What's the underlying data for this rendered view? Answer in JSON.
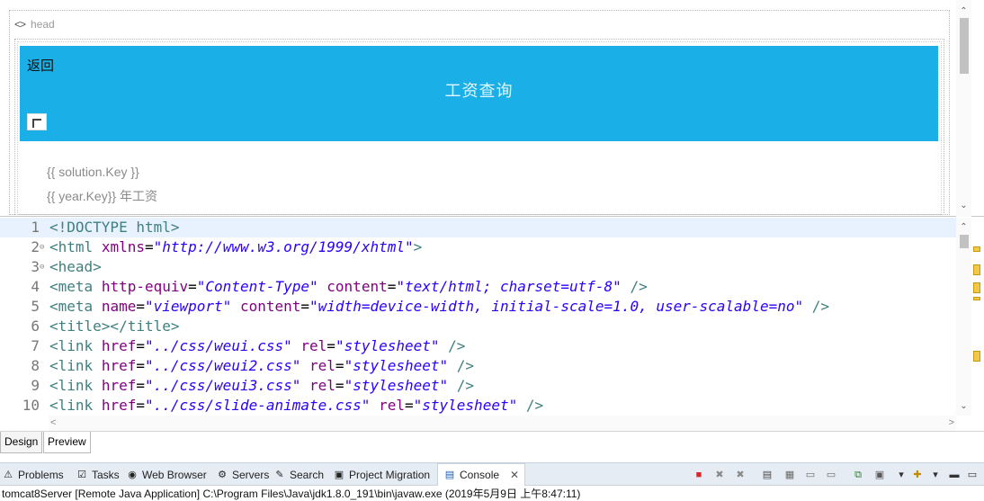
{
  "design": {
    "head_tag_icon": "<>",
    "head_tag": "head",
    "back_link": "返回",
    "page_heading": "工资查询",
    "template_line_1": "{{ solution.Key }}",
    "template_line_2": "{{ year.Key}} 年工资",
    "header_color": "#1aafe6"
  },
  "editor": {
    "lines": [
      {
        "num": "1",
        "fold": "",
        "current": true,
        "tokens": [
          {
            "t": "tag",
            "v": "<!DOCTYPE html>"
          }
        ]
      },
      {
        "num": "2",
        "fold": "⊖",
        "current": false,
        "tokens": [
          {
            "t": "tag",
            "v": "<html"
          },
          {
            "t": "txt",
            "v": " "
          },
          {
            "t": "attr",
            "v": "xmlns"
          },
          {
            "t": "txt",
            "v": "="
          },
          {
            "t": "str",
            "v": "\"http://www.w3.org/1999/xhtml\""
          },
          {
            "t": "tag",
            "v": ">"
          }
        ]
      },
      {
        "num": "3",
        "fold": "⊖",
        "current": false,
        "tokens": [
          {
            "t": "tag",
            "v": "<head>"
          }
        ]
      },
      {
        "num": "4",
        "fold": "",
        "current": false,
        "tokens": [
          {
            "t": "tag",
            "v": "<meta"
          },
          {
            "t": "txt",
            "v": " "
          },
          {
            "t": "attr",
            "v": "http-equiv"
          },
          {
            "t": "txt",
            "v": "="
          },
          {
            "t": "str",
            "v": "\"Content-Type\""
          },
          {
            "t": "txt",
            "v": " "
          },
          {
            "t": "attr",
            "v": "content"
          },
          {
            "t": "txt",
            "v": "="
          },
          {
            "t": "str",
            "v": "\"text/html; charset=utf-8\""
          },
          {
            "t": "txt",
            "v": " "
          },
          {
            "t": "tag",
            "v": "/>"
          }
        ]
      },
      {
        "num": "5",
        "fold": "",
        "current": false,
        "tokens": [
          {
            "t": "tag",
            "v": "<meta"
          },
          {
            "t": "txt",
            "v": " "
          },
          {
            "t": "attr",
            "v": "name"
          },
          {
            "t": "txt",
            "v": "="
          },
          {
            "t": "str",
            "v": "\"viewport\""
          },
          {
            "t": "txt",
            "v": " "
          },
          {
            "t": "attr",
            "v": "content"
          },
          {
            "t": "txt",
            "v": "="
          },
          {
            "t": "str",
            "v": "\"width=device-width, initial-scale=1.0, user-scalable=no\""
          },
          {
            "t": "txt",
            "v": " "
          },
          {
            "t": "tag",
            "v": "/>"
          }
        ]
      },
      {
        "num": "6",
        "fold": "",
        "current": false,
        "tokens": [
          {
            "t": "tag",
            "v": "<title></title>"
          }
        ]
      },
      {
        "num": "7",
        "fold": "",
        "current": false,
        "tokens": [
          {
            "t": "tag",
            "v": "<link"
          },
          {
            "t": "txt",
            "v": " "
          },
          {
            "t": "attr",
            "v": "href"
          },
          {
            "t": "txt",
            "v": "="
          },
          {
            "t": "str",
            "v": "\"../css/weui.css\""
          },
          {
            "t": "txt",
            "v": " "
          },
          {
            "t": "attr",
            "v": "rel"
          },
          {
            "t": "txt",
            "v": "="
          },
          {
            "t": "str",
            "v": "\"stylesheet\""
          },
          {
            "t": "txt",
            "v": " "
          },
          {
            "t": "tag",
            "v": "/>"
          }
        ]
      },
      {
        "num": "8",
        "fold": "",
        "current": false,
        "tokens": [
          {
            "t": "tag",
            "v": "<link"
          },
          {
            "t": "txt",
            "v": " "
          },
          {
            "t": "attr",
            "v": "href"
          },
          {
            "t": "txt",
            "v": "="
          },
          {
            "t": "str",
            "v": "\"../css/weui2.css\""
          },
          {
            "t": "txt",
            "v": " "
          },
          {
            "t": "attr",
            "v": "rel"
          },
          {
            "t": "txt",
            "v": "="
          },
          {
            "t": "str",
            "v": "\"stylesheet\""
          },
          {
            "t": "txt",
            "v": " "
          },
          {
            "t": "tag",
            "v": "/>"
          }
        ]
      },
      {
        "num": "9",
        "fold": "",
        "current": false,
        "tokens": [
          {
            "t": "tag",
            "v": "<link"
          },
          {
            "t": "txt",
            "v": " "
          },
          {
            "t": "attr",
            "v": "href"
          },
          {
            "t": "txt",
            "v": "="
          },
          {
            "t": "str",
            "v": "\"../css/weui3.css\""
          },
          {
            "t": "txt",
            "v": " "
          },
          {
            "t": "attr",
            "v": "rel"
          },
          {
            "t": "txt",
            "v": "="
          },
          {
            "t": "str",
            "v": "\"stylesheet\""
          },
          {
            "t": "txt",
            "v": " "
          },
          {
            "t": "tag",
            "v": "/>"
          }
        ]
      },
      {
        "num": "10",
        "fold": "",
        "current": false,
        "tokens": [
          {
            "t": "tag",
            "v": "<link"
          },
          {
            "t": "txt",
            "v": " "
          },
          {
            "t": "attr",
            "v": "href"
          },
          {
            "t": "txt",
            "v": "="
          },
          {
            "t": "str",
            "v": "\"../css/slide-animate.css\""
          },
          {
            "t": "txt",
            "v": " "
          },
          {
            "t": "attr",
            "v": "rel"
          },
          {
            "t": "txt",
            "v": "="
          },
          {
            "t": "str",
            "v": "\"stylesheet\""
          },
          {
            "t": "txt",
            "v": " "
          },
          {
            "t": "tag",
            "v": "/>"
          }
        ]
      }
    ],
    "colors": {
      "tag": "#3f7f7f",
      "attr": "#7f007f",
      "string": "#2a00ff",
      "current_line": "#e8f2fe"
    }
  },
  "mode_tabs": {
    "design": "Design",
    "preview": "Preview"
  },
  "views": {
    "tabs": [
      {
        "id": "problems",
        "label": "Problems",
        "icon": "problems-icon",
        "glyph": "⚠"
      },
      {
        "id": "tasks",
        "label": "Tasks",
        "icon": "tasks-icon",
        "glyph": "☑"
      },
      {
        "id": "web-browser",
        "label": "Web Browser",
        "icon": "web-browser-icon",
        "glyph": "◉"
      },
      {
        "id": "servers",
        "label": "Servers",
        "icon": "servers-icon",
        "glyph": "⚙"
      },
      {
        "id": "search",
        "label": "Search",
        "icon": "search-icon",
        "glyph": "✎"
      },
      {
        "id": "project-migration",
        "label": "Project Migration",
        "icon": "project-migration-icon",
        "glyph": "▣"
      }
    ],
    "active_tab": {
      "label": "Console",
      "icon": "console-icon",
      "glyph": "▤",
      "close": "✕"
    },
    "toolbar_icons": [
      "terminate-icon",
      "remove-launch-icon",
      "remove-all-icon",
      "scroll-lock-icon",
      "clear-console-icon",
      "show-when-stdout-icon",
      "show-when-stderr-icon",
      "pin-console-icon",
      "display-console-icon",
      "open-console-icon",
      "view-menu-icon",
      "minimize-icon",
      "maximize-icon"
    ],
    "toolbar_glyphs": [
      "■",
      "✖",
      "✖",
      "▤",
      "▦",
      "▭",
      "▭",
      "⧉",
      "▣",
      "▾",
      "✚",
      "▾",
      "▬",
      "▭"
    ]
  },
  "status_line": "tomcat8Server [Remote Java Application] C:\\Program Files\\Java\\jdk1.8.0_191\\bin\\javaw.exe (2019年5月9日 上午8:47:11)"
}
